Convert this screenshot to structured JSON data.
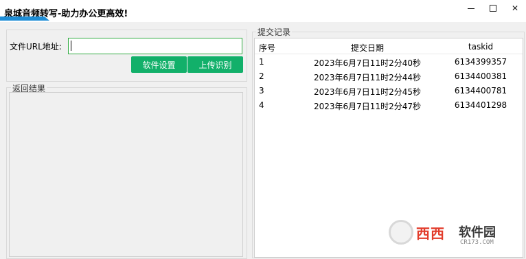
{
  "window": {
    "title": "泉城音频转写-助力办公更高效!",
    "minimize_glyph": "—",
    "close_glyph": "✕"
  },
  "form": {
    "url_label": "文件URL地址:",
    "url_value": "",
    "settings_button": "软件设置",
    "upload_button": "上传识别"
  },
  "result": {
    "group_caption": "返回结果",
    "text": ""
  },
  "records": {
    "group_caption": "提交记录",
    "columns": [
      "序号",
      "提交日期",
      "taskid"
    ],
    "rows": [
      {
        "idx": "1",
        "date": "2023年6月7日11时2分40秒",
        "taskid": "6134399357"
      },
      {
        "idx": "2",
        "date": "2023年6月7日11时2分44秒",
        "taskid": "6134400381"
      },
      {
        "idx": "3",
        "date": "2023年6月7日11时2分45秒",
        "taskid": "6134400781"
      },
      {
        "idx": "4",
        "date": "2023年6月7日11时2分47秒",
        "taskid": "6134401298"
      }
    ]
  },
  "watermark": {
    "brand_red": "西西",
    "brand_dark": "软件园",
    "domain": "CR173.COM"
  },
  "colors": {
    "accent_green": "#12b06a",
    "title_accent_blue": "#1f8ed6",
    "input_border_green": "#2eaa3f"
  }
}
